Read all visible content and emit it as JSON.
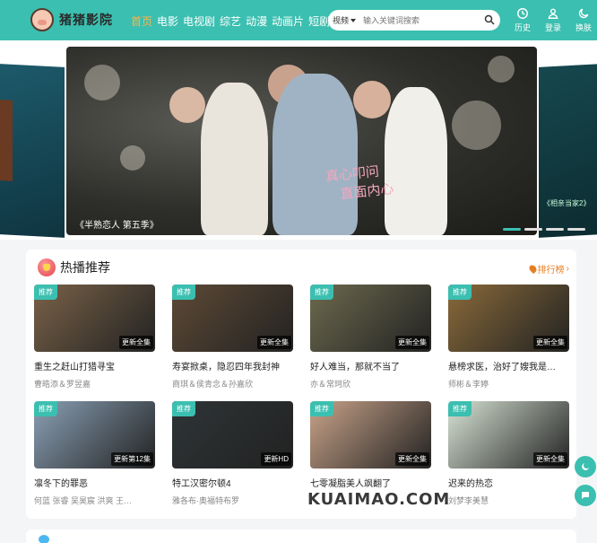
{
  "header": {
    "logo_text": "猪猪影院",
    "nav": [
      "首页",
      "电影",
      "电视剧",
      "综艺",
      "动漫",
      "动画片",
      "短剧"
    ],
    "active_nav": 0,
    "search": {
      "category": "视频",
      "placeholder": "输入关键词搜索"
    },
    "tools": [
      {
        "label": "历史",
        "icon": "history-icon"
      },
      {
        "label": "登录",
        "icon": "user-icon"
      },
      {
        "label": "换肤",
        "icon": "moon-icon"
      }
    ]
  },
  "banner": {
    "caption": "《半熟恋人 第五季》",
    "overlay_text_1": "真心叩问",
    "overlay_text_2": "直面内心",
    "right_peek_label": "《相亲当家2》",
    "slide_count": 5,
    "active_slide": 0
  },
  "hot": {
    "title": "热播推荐",
    "rank_link": "排行榜",
    "items": [
      {
        "tag": "推荐",
        "status": "更新全集",
        "title": "重生之赶山打猎寻宝",
        "cast": "曹皓添＆罗昱嘉",
        "color": "#7a6248"
      },
      {
        "tag": "推荐",
        "status": "更新全集",
        "title": "寿宴掀桌，隐忍四年我封神",
        "cast": "商琪＆侯青念＆孙嘉欣",
        "color": "#5e4a36"
      },
      {
        "tag": "推荐",
        "status": "更新全集",
        "title": "好人难当，那就不当了",
        "cast": "亦＆常珂欣",
        "color": "#6d6a4e"
      },
      {
        "tag": "推荐",
        "status": "更新全集",
        "title": "悬榜求医，治好了嫂我是…",
        "cast": "师彬＆李婷",
        "color": "#8a6a3a"
      },
      {
        "tag": "推荐",
        "status": "更新第12集",
        "title": "凛冬下的罪恶",
        "cast": "何蓝 张睿 吴昊宸 洪爽 王…",
        "color": "#8aa0b5"
      },
      {
        "tag": "推荐",
        "status": "更新HD",
        "title": "特工汉密尔顿4",
        "cast": "雅各布·奥福特布罗",
        "color": "#2e3436"
      },
      {
        "tag": "推荐",
        "status": "更新全集",
        "title": "七零凝脂美人飒翻了",
        "cast": "",
        "color": "#c9a389"
      },
      {
        "tag": "推荐",
        "status": "更新全集",
        "title": "迟来的热恋",
        "cast": "刘梦李美慧",
        "color": "#d7e3d4"
      }
    ]
  },
  "watermark": {
    "text": "KUAIMAO.COM"
  }
}
